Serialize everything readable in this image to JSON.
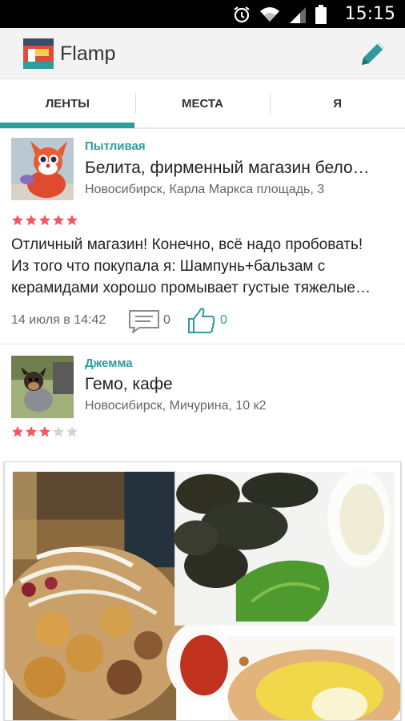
{
  "status_bar": {
    "time": "15:15",
    "icons": [
      "alarm-icon",
      "wifi-icon",
      "signal-icon",
      "battery-icon"
    ]
  },
  "app_bar": {
    "title": "Flamp",
    "action_icon": "pencil-icon"
  },
  "tabs": [
    {
      "label": "ЛЕНТЫ",
      "selected": true
    },
    {
      "label": "МЕСТА",
      "selected": false
    },
    {
      "label": "Я",
      "selected": false
    }
  ],
  "feed": [
    {
      "author": "Пытливая",
      "place": "Белита, фирменный магазин бело…",
      "address": "Новосибирск, Карла Маркса площадь, 3",
      "rating": 5,
      "review_lines": [
        "Отличный магазин! Конечно, всё надо пробовать!",
        "Из того что покупала я: Шампунь+бальзам с",
        "керамидами хорошо промывает  густые тяжелые…"
      ],
      "date": "14 июля в 14:42",
      "comments": "0",
      "likes": "0"
    },
    {
      "author": "Джемма",
      "place": "Гемо, кафе",
      "address": "Новосибирск, Мичурина, 10 к2",
      "rating": 3
    }
  ],
  "colors": {
    "accent": "#2e9b9f",
    "star_on": "#ee5a63",
    "star_off": "#d4d4d4",
    "status_bar": "#000000",
    "app_bar": "#f3f3f3"
  }
}
